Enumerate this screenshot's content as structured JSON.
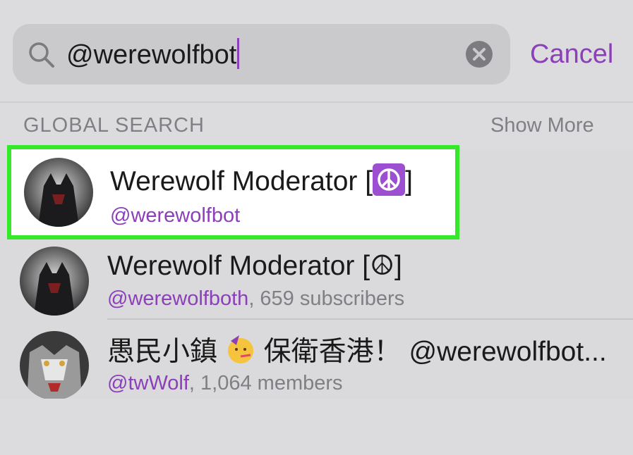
{
  "search": {
    "query": "@werewolfbot",
    "cancel_label": "Cancel"
  },
  "section": {
    "title": "GLOBAL SEARCH",
    "show_more_label": "Show More"
  },
  "results": [
    {
      "title_prefix": "Werewolf Moderator [",
      "title_suffix": "]",
      "handle": "@werewolfbot",
      "meta": ""
    },
    {
      "title": "Werewolf Moderator [☮]",
      "handle": "@werewolfboth",
      "meta": ", 659 subscribers"
    },
    {
      "title_prefix": "愚民小鎮 ",
      "title_suffix": " 保衛香港！ @werewolfbot...",
      "handle": "@twWolf",
      "meta": ", 1,064 members"
    }
  ],
  "colors": {
    "accent": "#8b3fb8",
    "highlight": "#35e82a",
    "muted": "#7f7f84"
  }
}
